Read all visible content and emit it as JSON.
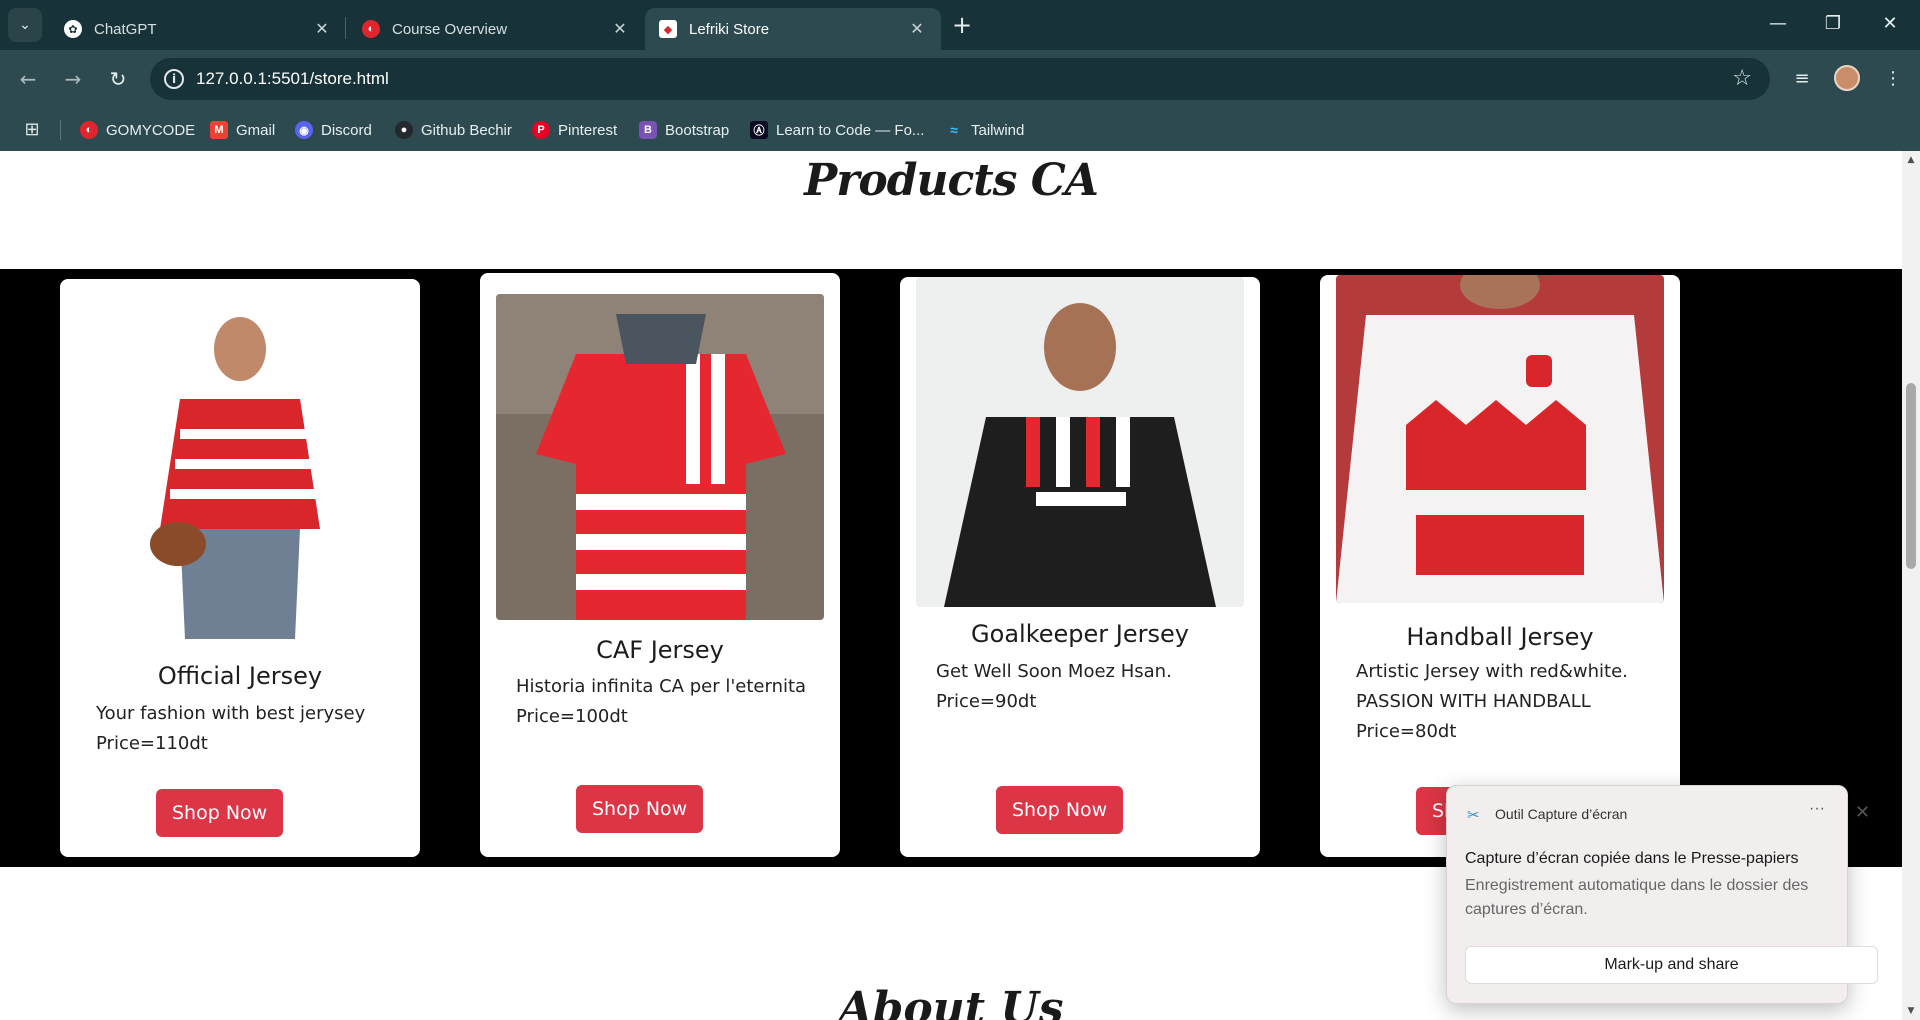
{
  "browser": {
    "tabs": [
      {
        "title": "ChatGPT",
        "icon": "chatgpt-icon"
      },
      {
        "title": "Course Overview",
        "icon": "gomycode-icon"
      },
      {
        "title": "Lefriki Store",
        "icon": "club-africain-icon",
        "active": true
      }
    ],
    "url": "127.0.0.1:5501/store.html",
    "bookmarks": [
      {
        "label": "GOMYCODE",
        "icon": "gomycode-icon",
        "color": "#e0262d"
      },
      {
        "label": "Gmail",
        "icon": "gmail-icon",
        "color": "#ea4335"
      },
      {
        "label": "Discord",
        "icon": "discord-icon",
        "color": "#5865f2"
      },
      {
        "label": "Github Bechir",
        "icon": "github-icon",
        "color": "#24292f"
      },
      {
        "label": "Pinterest",
        "icon": "pinterest-icon",
        "color": "#e60023"
      },
      {
        "label": "Bootstrap",
        "icon": "bootstrap-icon",
        "color": "#7952b3"
      },
      {
        "label": "Learn to Code — Fo...",
        "icon": "freecodecamp-icon",
        "color": "#0a0a23"
      },
      {
        "label": "Tailwind",
        "icon": "tailwind-icon",
        "color": "#38bdf8"
      }
    ]
  },
  "page": {
    "heading": "Products CA",
    "about_heading": "About Us",
    "accent_color": "#dc3545",
    "products": [
      {
        "name": "Official Jersey",
        "description": "Your fashion with best jerysey",
        "price": "Price=110dt",
        "button": "Shop Now"
      },
      {
        "name": "CAF Jersey",
        "description": "Historia infinita CA per l'eternita",
        "price": "Price=100dt",
        "button": "Shop Now"
      },
      {
        "name": "Goalkeeper Jersey",
        "description": "Get Well Soon Moez Hsan.",
        "price": "Price=90dt",
        "button": "Shop Now"
      },
      {
        "name": "Handball Jersey",
        "description": "Artistic Jersey with red&white. PASSION WITH HANDBALL",
        "price": "Price=80dt",
        "button": "Shop Now"
      }
    ]
  },
  "toast": {
    "app": "Outil Capture d’écran",
    "title": "Capture d’écran copiée dans le Presse-papiers",
    "body": "Enregistrement automatique dans le dossier des captures d’écran.",
    "action": "Mark-up and share"
  }
}
